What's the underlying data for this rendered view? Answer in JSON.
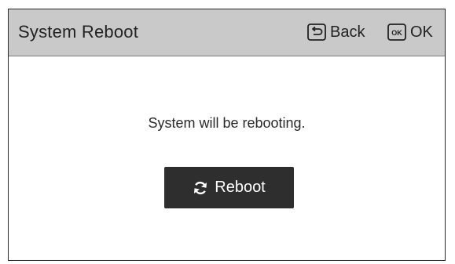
{
  "header": {
    "title": "System Reboot",
    "back_label": "Back",
    "ok_label": "OK",
    "back_key_icon": "back-key-icon",
    "ok_key_icon": "ok-key-icon",
    "ok_key_text": "OK"
  },
  "main": {
    "message": "System will be rebooting.",
    "reboot_label": "Reboot",
    "reboot_icon": "refresh-icon"
  },
  "colors": {
    "header_bg": "#c9c9c9",
    "button_bg": "#2e2e2e",
    "button_text": "#ffffff",
    "text": "#222222"
  }
}
